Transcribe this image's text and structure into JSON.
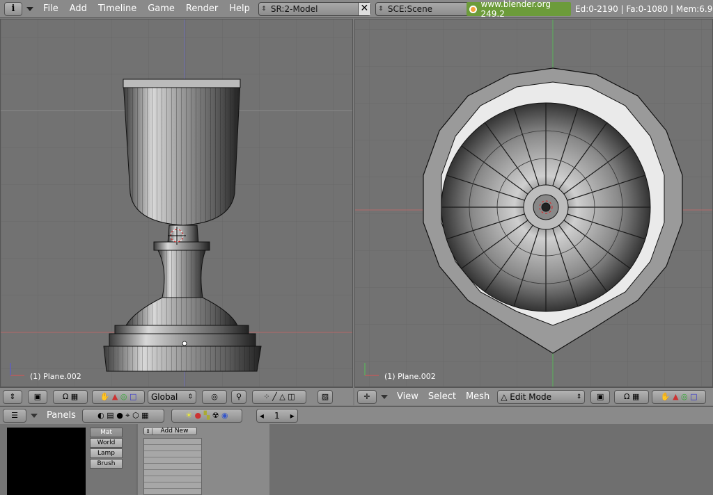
{
  "topbar": {
    "info_icon": "i",
    "menus": [
      "File",
      "Add",
      "Timeline",
      "Game",
      "Render",
      "Help"
    ],
    "screen_field": "SR:2-Model",
    "scene_field": "SCE:Scene",
    "url": "www.blender.org 249.2",
    "stats": "Ed:0-2190 | Fa:0-1080 | Mem:6.9"
  },
  "viewport_left": {
    "object_label": "(1) Plane.002"
  },
  "viewport_right": {
    "object_label": "(1) Plane.002"
  },
  "header_left": {
    "orientation": "Global"
  },
  "header_right": {
    "menus": [
      "View",
      "Select",
      "Mesh"
    ],
    "mode": "Edit Mode"
  },
  "buttons_header": {
    "panels_label": "Panels",
    "frame_value": "1"
  },
  "buttons_area": {
    "tabs": [
      "Mat",
      "World",
      "Lamp",
      "Brush"
    ],
    "add_new_label": "Add New"
  },
  "colors": {
    "viewport_bg": "#727272",
    "grid": "#666666",
    "axis_x": "#c85a5a",
    "axis_y": "#5ab45a",
    "url_bg": "#6c9b3a"
  }
}
